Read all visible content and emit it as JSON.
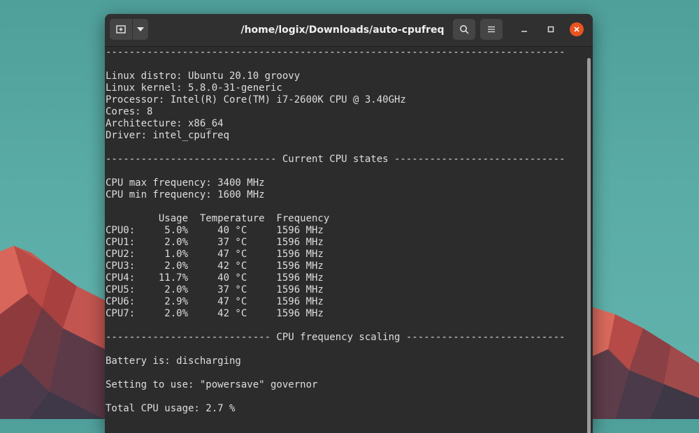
{
  "window": {
    "title": "/home/logix/Downloads/auto-cpufreq"
  },
  "icons": {
    "new_tab": "new-tab-icon",
    "dropdown": "chevron-down-icon",
    "search": "search-icon",
    "menu": "hamburger-menu-icon",
    "minimize": "minimize-icon",
    "maximize": "maximize-icon",
    "close": "close-icon"
  },
  "colors": {
    "terminal_bg": "#2c2c2c",
    "titlebar_bg": "#303030",
    "close_button": "#e95420",
    "text": "#dedede"
  },
  "terminal": {
    "lines": [
      "------------------------------------------------------------------------------",
      "",
      "Linux distro: Ubuntu 20.10 groovy",
      "Linux kernel: 5.8.0-31-generic",
      "Processor: Intel(R) Core(TM) i7-2600K CPU @ 3.40GHz",
      "Cores: 8",
      "Architecture: x86_64",
      "Driver: intel_cpufreq",
      "",
      "----------------------------- Current CPU states -----------------------------",
      "",
      "CPU max frequency: 3400 MHz",
      "CPU min frequency: 1600 MHz",
      "",
      "         Usage  Temperature  Frequency",
      "CPU0:     5.0%     40 °C     1596 MHz",
      "CPU1:     2.0%     37 °C     1596 MHz",
      "CPU2:     1.0%     47 °C     1596 MHz",
      "CPU3:     2.0%     42 °C     1596 MHz",
      "CPU4:    11.7%     40 °C     1596 MHz",
      "CPU5:     2.0%     37 °C     1596 MHz",
      "CPU6:     2.9%     47 °C     1596 MHz",
      "CPU7:     2.0%     42 °C     1596 MHz",
      "",
      "---------------------------- CPU frequency scaling ---------------------------",
      "",
      "Battery is: discharging",
      "",
      "Setting to use: \"powersave\" governor",
      "",
      "Total CPU usage: 2.7 %"
    ]
  }
}
